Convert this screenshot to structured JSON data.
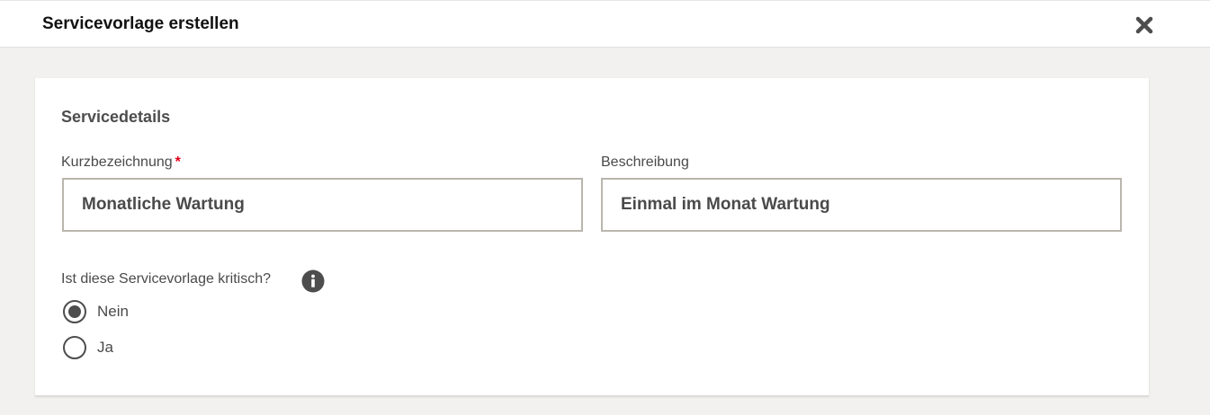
{
  "header": {
    "title": "Servicevorlage erstellen",
    "close_icon": "close-icon"
  },
  "section": {
    "title": "Servicedetails"
  },
  "fields": {
    "kurzbezeichnung": {
      "label": "Kurzbezeichnung",
      "required_mark": "*",
      "value": "Monatliche Wartung"
    },
    "beschreibung": {
      "label": "Beschreibung",
      "value": "Einmal im Monat Wartung"
    }
  },
  "critical": {
    "question": "Ist diese Servicevorlage kritisch?",
    "info_icon": "info-icon",
    "options": [
      {
        "label": "Nein",
        "selected": true
      },
      {
        "label": "Ja",
        "selected": false
      }
    ]
  },
  "colors": {
    "required": "#e0001a",
    "border": "#b9b6ad",
    "background": "#f2f1ef"
  }
}
